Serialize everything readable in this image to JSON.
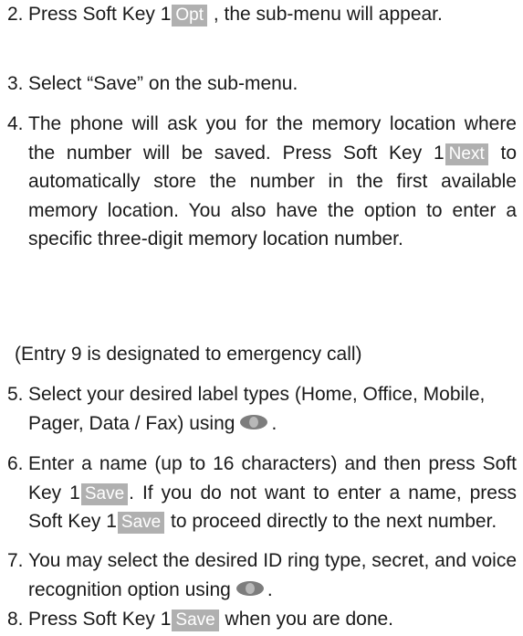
{
  "steps": [
    {
      "num": "2.",
      "before": "Press Soft Key 1",
      "key": "Opt",
      "after": " , the sub-menu will appear."
    },
    {
      "num": "3.",
      "text": "Select “Save” on the sub-menu."
    },
    {
      "num": "4.",
      "before": "The phone will ask you for the memory location where the number will be saved. Press Soft Key 1",
      "key": "Next",
      "after": " to automatically store the number in the first available memory location. You also have the option to enter a specific three-digit memory location number."
    },
    {
      "num": "5.",
      "before": "Select your desired label types (Home, Office, Mobile, Pager, Data / Fax) using",
      "icon": "navigation-key-icon",
      "after": "."
    },
    {
      "num": "6.",
      "before": "Enter a name (up to 16 characters) and then press Soft Key 1",
      "key": "Save",
      "middle": ". If you do not want to enter a name, press Soft Key 1",
      "key2": "Save",
      "after": " to proceed directly to the next number."
    },
    {
      "num": "7.",
      "before": "You may select the desired ID ring type, secret, and voice recognition option using",
      "icon": "navigation-key-icon",
      "after": "."
    },
    {
      "num": "8.",
      "before": "Press Soft Key 1",
      "key": "Save",
      "after": " when you are done."
    }
  ],
  "note": "(Entry 9 is designated to emergency call)",
  "colors": {
    "key_bg": "#b0b0b0",
    "key_text": "#ffffff",
    "icon": "#7d7d7d"
  }
}
